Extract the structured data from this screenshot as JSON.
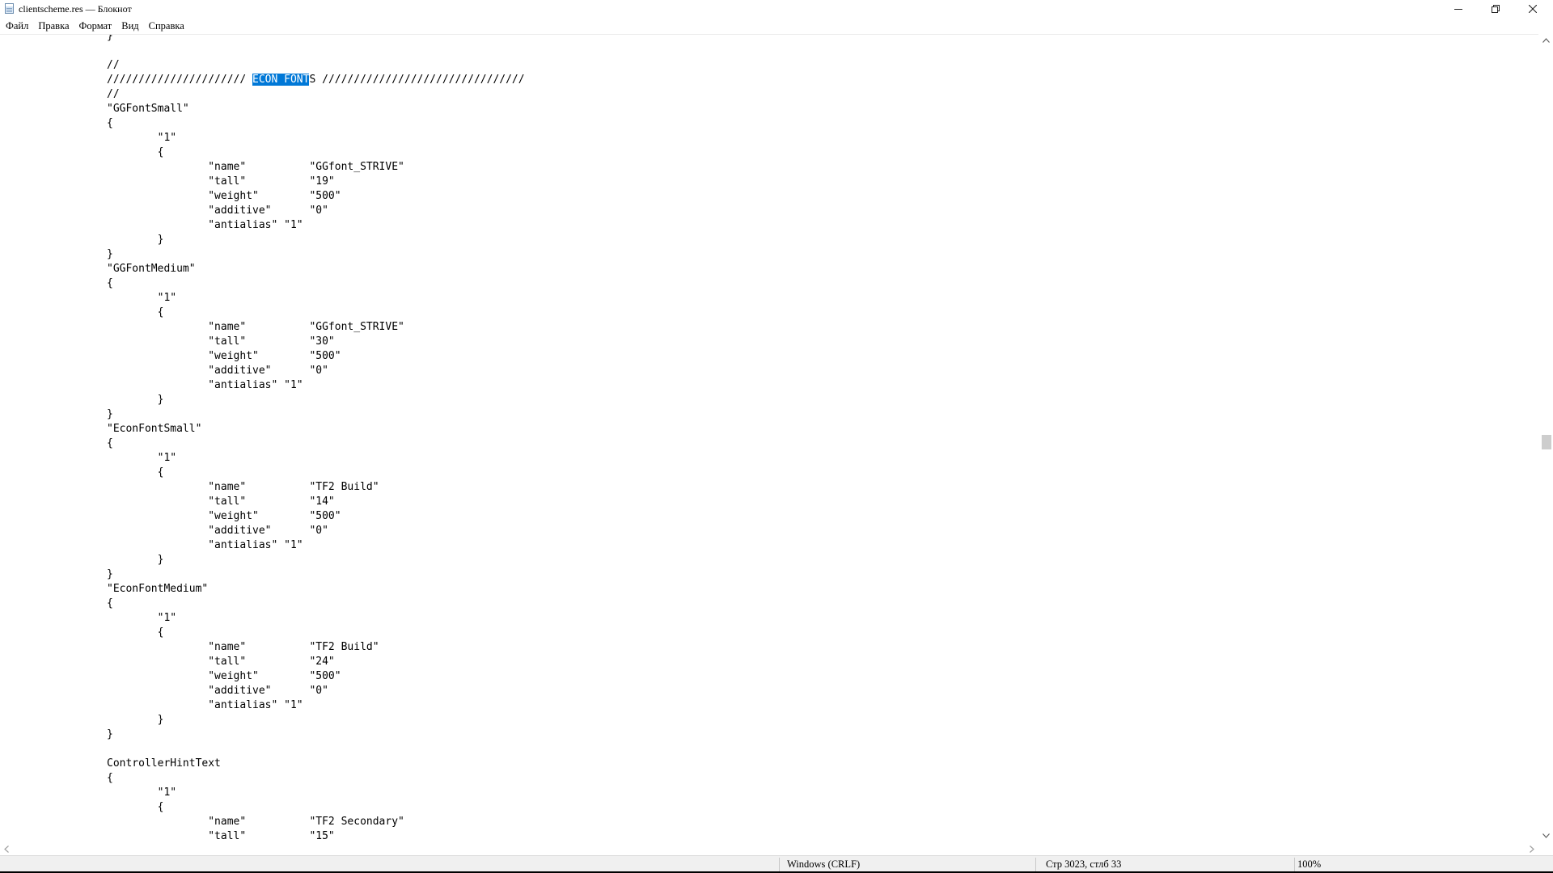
{
  "window": {
    "title": "clientscheme.res — Блокнот"
  },
  "menu": {
    "items": [
      "Файл",
      "Правка",
      "Формат",
      "Вид",
      "Справка"
    ]
  },
  "icons": {
    "app": "notepad-icon",
    "minimize": "minimize-icon",
    "maximize": "restore-icon",
    "close": "close-icon",
    "scroll_up": "scroll-up-arrow-icon",
    "scroll_down": "scroll-down-arrow-icon",
    "scroll_left": "scroll-left-arrow-icon",
    "scroll_right": "scroll-right-arrow-icon"
  },
  "colors": {
    "selection": "#0078d7",
    "selection_text": "#ffffff"
  },
  "editor": {
    "selected_text": "ECON FONT",
    "lines": [
      "}",
      "",
      "//",
      "////////////////////// ECON FONTS ////////////////////////////////",
      "//",
      "\"GGFontSmall\"",
      "{",
      "\t\"1\"",
      "\t{",
      "\t\t\"name\"\t\t\"GGfont_STRIVE\"",
      "\t\t\"tall\"\t\t\"19\"",
      "\t\t\"weight\"\t\"500\"",
      "\t\t\"additive\"\t\"0\"",
      "\t\t\"antialias\" \"1\"",
      "\t}",
      "}",
      "\"GGFontMedium\"",
      "{",
      "\t\"1\"",
      "\t{",
      "\t\t\"name\"\t\t\"GGfont_STRIVE\"",
      "\t\t\"tall\"\t\t\"30\"",
      "\t\t\"weight\"\t\"500\"",
      "\t\t\"additive\"\t\"0\"",
      "\t\t\"antialias\" \"1\"",
      "\t}",
      "}",
      "\"EconFontSmall\"",
      "{",
      "\t\"1\"",
      "\t{",
      "\t\t\"name\"\t\t\"TF2 Build\"",
      "\t\t\"tall\"\t\t\"14\"",
      "\t\t\"weight\"\t\"500\"",
      "\t\t\"additive\"\t\"0\"",
      "\t\t\"antialias\" \"1\"",
      "\t}",
      "}",
      "\"EconFontMedium\"",
      "{",
      "\t\"1\"",
      "\t{",
      "\t\t\"name\"\t\t\"TF2 Build\"",
      "\t\t\"tall\"\t\t\"24\"",
      "\t\t\"weight\"\t\"500\"",
      "\t\t\"additive\"\t\"0\"",
      "\t\t\"antialias\" \"1\"",
      "\t}",
      "}",
      "",
      "ControllerHintText",
      "{",
      "\t\"1\"",
      "\t{",
      "\t\t\"name\"\t\t\"TF2 Secondary\"",
      "\t\t\"tall\"\t\t\"15\""
    ]
  },
  "statusbar": {
    "line_ending": "Windows (CRLF)",
    "position": "Стр 3023, стлб 33",
    "zoom": "100%"
  }
}
